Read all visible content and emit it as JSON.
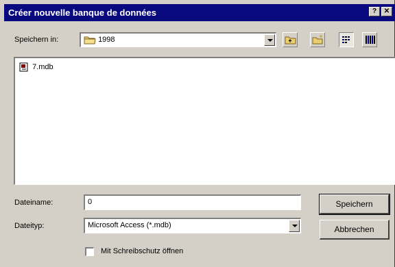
{
  "window": {
    "title": "Créer nouvelle banque de données",
    "help_glyph": "?",
    "close_glyph": "✕"
  },
  "location": {
    "label": "Speichern in:",
    "value": "1998",
    "folder_icon": "folder-icon"
  },
  "toolbar": {
    "up_icon": "up-folder-icon",
    "new_folder_icon": "new-folder-icon",
    "list_view_icon": "list-view-icon",
    "details_view_icon": "details-view-icon"
  },
  "files": [
    {
      "name": "7.mdb",
      "icon": "access-file-icon"
    }
  ],
  "filename": {
    "label": "Dateiname:",
    "value": "0"
  },
  "filetype": {
    "label": "Dateityp:",
    "value": "Microsoft Access (*.mdb)"
  },
  "buttons": {
    "save": "Speichern",
    "cancel": "Abbrechen"
  },
  "readonly": {
    "label": "Mit Schreibschutz öffnen",
    "checked": false
  }
}
